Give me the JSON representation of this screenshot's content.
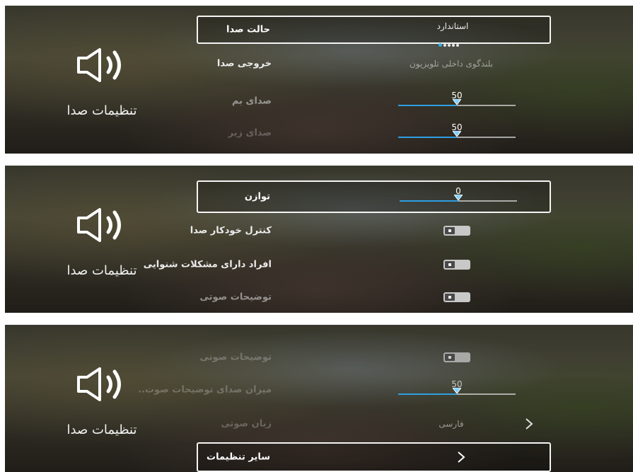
{
  "title": "تنظیمات صدا",
  "icon": "speaker-volume-icon",
  "colors": {
    "accent": "#2f9fe0",
    "highlight_border": "#f4f4f4",
    "text": "#ffffff"
  },
  "panel1": {
    "sound_mode": {
      "label": "حالت صدا",
      "value": "استاندارد",
      "page_dots": 5,
      "active_dot": 1
    },
    "sound_output": {
      "label": "خروجی صدا",
      "value": "بلندگوی داخلی تلویزیون"
    },
    "bass": {
      "label": "صدای بم",
      "value": "50",
      "level": 0.5
    },
    "treble": {
      "label": "صدای زیر",
      "value": "50",
      "level": 0.5
    }
  },
  "panel2": {
    "balance": {
      "label": "توازن",
      "value": "0",
      "level": 0.5
    },
    "auto_volume": {
      "label": "کنترل خودکار صدا",
      "on": false
    },
    "hearing_impaired": {
      "label": "افراد دارای مشکلات شنوایی",
      "on": false
    },
    "audio_description": {
      "label": "توضیحات صوتی",
      "on": false
    }
  },
  "panel3": {
    "audio_description": {
      "label": "توضیحات صوتی",
      "on": false
    },
    "ad_volume": {
      "label": "میزان صدای توضیحات صوت..",
      "value": "50",
      "level": 0.5
    },
    "audio_language": {
      "label": "زبان صوتی",
      "value": "فارسی"
    },
    "other_settings": {
      "label": "سایر تنظیمات"
    }
  }
}
